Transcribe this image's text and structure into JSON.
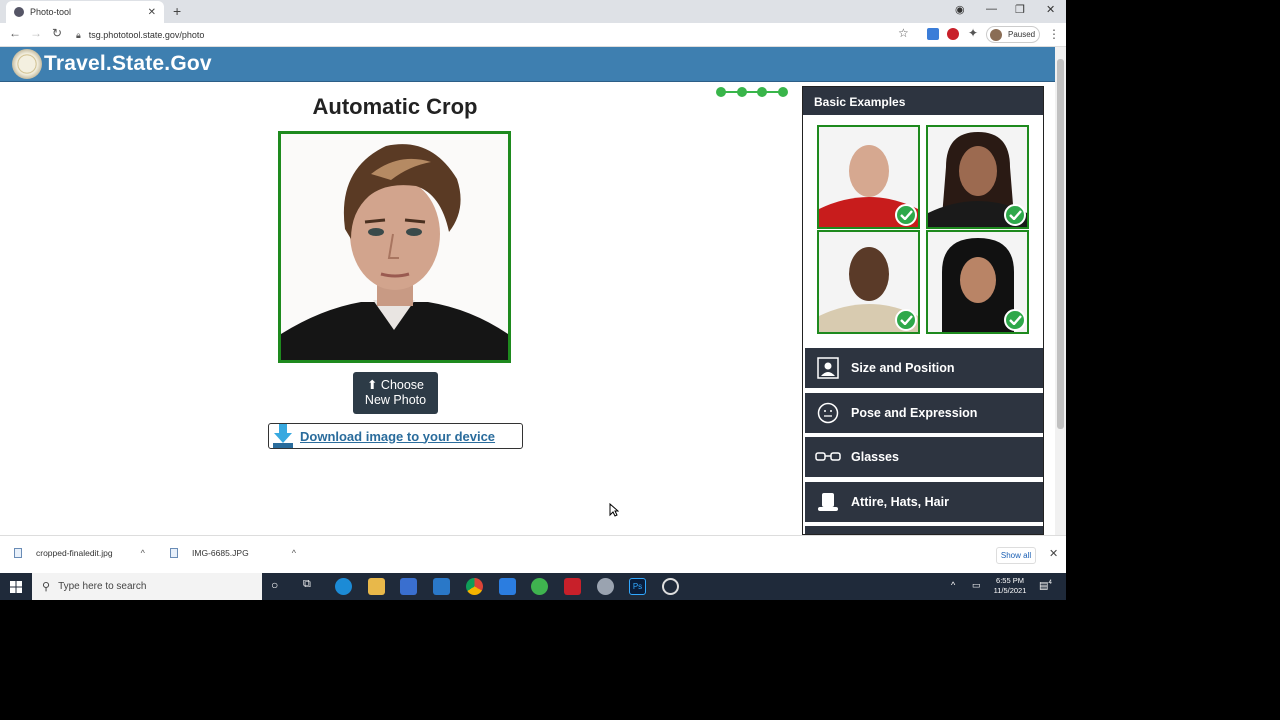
{
  "browser": {
    "tab_title": "Photo-tool",
    "url": "tsg.phototool.state.gov/photo",
    "profile_status": "Paused"
  },
  "site": {
    "title": "Travel.State.Gov"
  },
  "main": {
    "heading": "Automatic Crop",
    "choose_button": {
      "line1": "Choose",
      "line2": "New Photo"
    },
    "download_link": "Download image to your device",
    "progress_steps": 4
  },
  "panel": {
    "header": "Basic Examples",
    "examples": [
      "example-photo-man-red-shirt",
      "example-photo-woman-dark-top",
      "example-photo-man-beige-shirt",
      "example-photo-woman-hijab"
    ],
    "items": [
      {
        "label": "Size and Position",
        "icon": "portrait-icon"
      },
      {
        "label": "Pose and Expression",
        "icon": "face-icon"
      },
      {
        "label": "Glasses",
        "icon": "glasses-icon"
      },
      {
        "label": "Attire, Hats, Hair",
        "icon": "hat-icon"
      }
    ]
  },
  "downloads": {
    "files": [
      "cropped-finaledit.jpg",
      "IMG-6685.JPG"
    ],
    "show_all": "Show all"
  },
  "taskbar": {
    "search_placeholder": "Type here to search",
    "time": "6:55 PM",
    "date": "11/5/2021",
    "notification_count": "4"
  },
  "colors": {
    "header_blue": "#3e7fb0",
    "panel_dark": "#2d3440",
    "approved_green": "#1e8a1e",
    "link_blue": "#2a6c9c"
  }
}
